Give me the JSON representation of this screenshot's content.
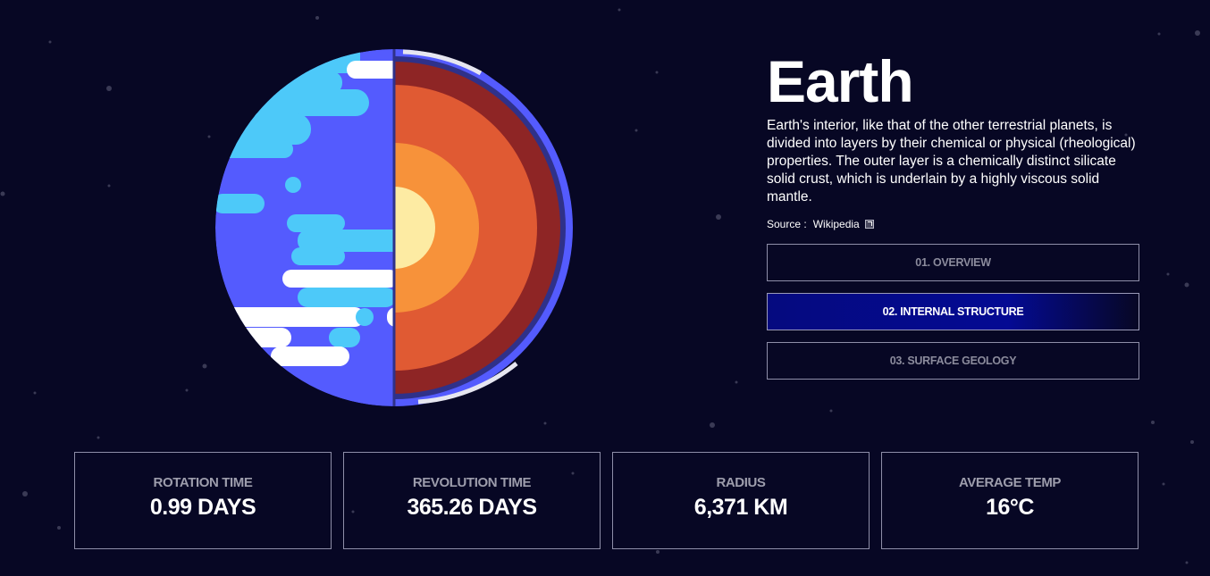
{
  "planet": {
    "name": "Earth",
    "description": "Earth's interior, like that of the other terrestrial planets, is divided into layers by their chemical or physical (rheological) properties. The outer layer is a chemically distinct silicate solid crust, which is underlain by a highly viscous solid mantle.",
    "source_label": "Source :",
    "source_link": "Wikipedia",
    "source_icon": "external-link-icon"
  },
  "tabs": [
    {
      "label": "01. OVERVIEW",
      "active": false
    },
    {
      "label": "02. INTERNAL STRUCTURE",
      "active": true
    },
    {
      "label": "03. SURFACE GEOLOGY",
      "active": false
    }
  ],
  "stats": [
    {
      "label": "ROTATION TIME",
      "value": "0.99 DAYS"
    },
    {
      "label": "REVOLUTION TIME",
      "value": "365.26 DAYS"
    },
    {
      "label": "RADIUS",
      "value": "6,371 KM"
    },
    {
      "label": "AVERAGE TEMP",
      "value": "16°C"
    }
  ],
  "colors": {
    "background": "#070724",
    "accent": "#040a93",
    "ocean": "#545bfe",
    "land": "#4dc9f9",
    "core_inner": "#fdeba3",
    "core_outer": "#f7923a",
    "mantle": "#e05a33",
    "crust": "#8e2525"
  }
}
